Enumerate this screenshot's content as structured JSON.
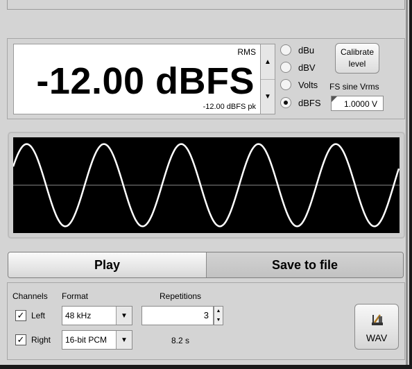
{
  "level": {
    "rms_label": "RMS",
    "value": "-12.00 dBFS",
    "peak": "-12.00 dBFS pk",
    "units": [
      {
        "label": "dBu",
        "checked": false
      },
      {
        "label": "dBV",
        "checked": false
      },
      {
        "label": "Volts",
        "checked": false
      },
      {
        "label": "dBFS",
        "checked": true
      }
    ],
    "calibrate_label": "Calibrate level",
    "fs_sine_label": "FS sine Vrms",
    "fs_sine_value": "1.0000 V"
  },
  "scope": {
    "background": "#000000",
    "trace_color": "#ffffff",
    "cycles": 5,
    "amplitude_fraction": 0.86
  },
  "actions": {
    "play_label": "Play",
    "save_label": "Save to file"
  },
  "output": {
    "channels_label": "Channels",
    "left_label": "Left",
    "left_checked": true,
    "right_label": "Right",
    "right_checked": true,
    "format_label": "Format",
    "sample_rate": "48 kHz",
    "bit_depth": "16-bit PCM",
    "repetitions_label": "Repetitions",
    "repetitions_value": "3",
    "duration": "8.2 s",
    "wav_label": "WAV"
  }
}
